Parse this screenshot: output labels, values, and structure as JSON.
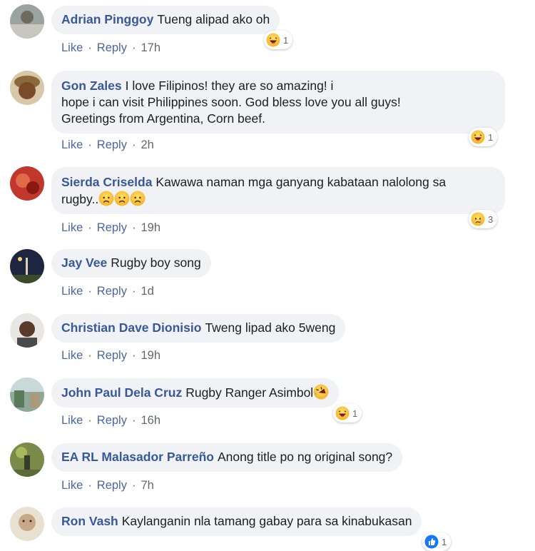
{
  "actions": {
    "like": "Like",
    "reply": "Reply",
    "separator": "·"
  },
  "comments": [
    {
      "author": "Adrian Pinggoy",
      "text": "Tueng alipad ako oh",
      "time": "17h",
      "reaction": {
        "icon": "haha-icon",
        "count": "1"
      }
    },
    {
      "author": "Gon Zales",
      "text": "I love Filipinos! they are so amazing! i",
      "text2": "hope i can visit Philippines soon. God bless love you all guys!",
      "text3": "Greetings from Argentina, Corn beef.",
      "time": "2h",
      "reaction": {
        "icon": "haha-icon",
        "count": "1"
      }
    },
    {
      "author": "Sierda Criselda",
      "text": "Kawawa naman mga ganyang kabataan nalolong sa",
      "text2": "rugby..",
      "text2_emojis": [
        "sad-face-icon",
        "sad-face-icon",
        "sad-face-icon"
      ],
      "time": "19h",
      "reaction": {
        "icon": "sad-icon",
        "count": "3"
      }
    },
    {
      "author": "Jay Vee",
      "text": "Rugby boy song",
      "time": "1d"
    },
    {
      "author": "Christian Dave Dionisio",
      "text": "Tweng lipad ako 5weng",
      "time": "19h"
    },
    {
      "author": "John Paul Dela Cruz",
      "text": "Rugby Ranger Asimbol",
      "trailing_emoji": "rofl-icon",
      "time": "16h",
      "reaction": {
        "icon": "haha-icon",
        "count": "1"
      }
    },
    {
      "author": "EA RL Malasador Parreño",
      "text": "Anong title po ng original song?",
      "time": "7h"
    },
    {
      "author": "Ron Vash",
      "text": "Kaylanganin nla tamang gabay para sa kinabukasan",
      "reaction": {
        "icon": "like-icon",
        "count": "1"
      }
    }
  ],
  "colors": {
    "author": "#385898",
    "bubble": "#f0f2f5",
    "action": "#4b67a1",
    "muted": "#65676b",
    "like_blue": "#1877f2"
  }
}
